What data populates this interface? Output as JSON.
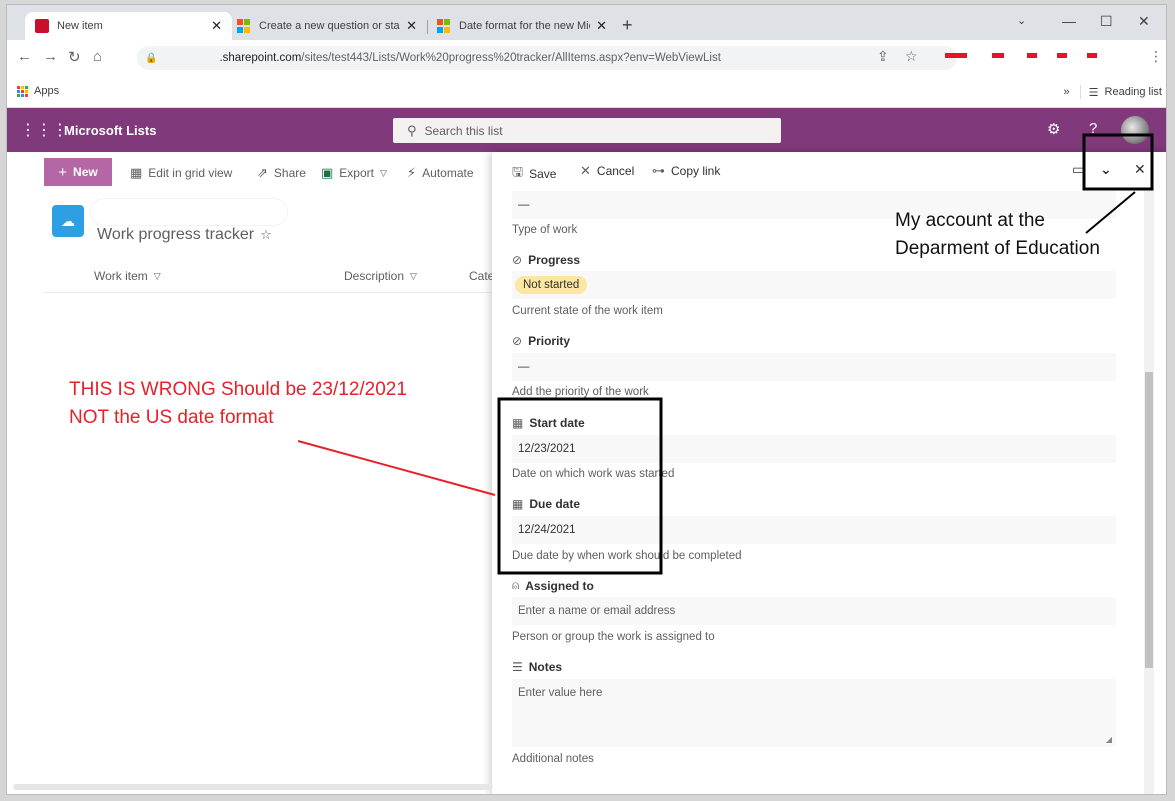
{
  "browser": {
    "tabs": [
      {
        "title": "New item",
        "active": true,
        "favicon": "sharepoint-favicon"
      },
      {
        "title": "Create a new question or start a",
        "active": false,
        "favicon": "microsoft-favicon"
      },
      {
        "title": "Date format for the new Microso",
        "active": false,
        "favicon": "microsoft-favicon"
      }
    ],
    "new_tab": "+",
    "url_main": ".sharepoint.com",
    "url_rest": "/sites/test443/Lists/Work%20progress%20tracker/AllItems.aspx?env=WebViewList",
    "bookmarks": {
      "apps_label": "Apps",
      "overflow": "»",
      "reading_list": "Reading list"
    }
  },
  "suite": {
    "app_name": "Microsoft Lists",
    "search_placeholder": "Search this list",
    "help": "?"
  },
  "command_bar": {
    "new": "New",
    "edit_grid": "Edit in grid view",
    "share": "Share",
    "export": "Export",
    "automate": "Automate"
  },
  "list": {
    "title": "Work progress tracker",
    "columns": [
      "Work item",
      "Description",
      "Cate"
    ]
  },
  "panel": {
    "save": "Save",
    "cancel": "Cancel",
    "copy_link": "Copy link",
    "fields": {
      "type_of_work": {
        "value": "—",
        "description": "Type of work"
      },
      "progress": {
        "label": "Progress",
        "value": "Not started",
        "description": "Current state of the work item"
      },
      "priority": {
        "label": "Priority",
        "value": "—",
        "description": "Add the priority of the work"
      },
      "start_date": {
        "label": "Start date",
        "value": "12/23/2021",
        "description": "Date on which work was started"
      },
      "due_date": {
        "label": "Due date",
        "value": "12/24/2021",
        "description": "Due date by when work should be completed"
      },
      "assigned_to": {
        "label": "Assigned to",
        "placeholder": "Enter a name or email address",
        "description": "Person or group the work is assigned to"
      },
      "notes": {
        "label": "Notes",
        "placeholder": "Enter value here",
        "description": "Additional notes"
      }
    }
  },
  "annotations": {
    "red_line1": "THIS IS WRONG Should be 23/12/2021",
    "red_line2": "NOT the US date format",
    "black_line1": "My account at the",
    "black_line2": "Deparment of Education"
  },
  "colors": {
    "suite_bar": "#80397b",
    "new_button": "#b566a5",
    "progress_badge": "#fce7a2",
    "annotation_red": "#e8202a"
  }
}
